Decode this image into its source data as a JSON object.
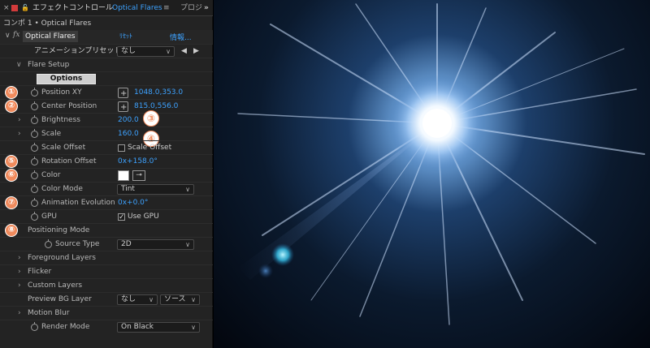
{
  "tabs": {
    "close_glyph": "×",
    "lock_glyph": "🔓",
    "effect_controls_label": "エフェクトコントロール",
    "effect_name": "Optical Flares",
    "menu_glyph": "≡",
    "project_tab": "プロジ",
    "overflow_glyph": "»"
  },
  "comp_path": "コンポ 1 • Optical Flares",
  "effect_header": {
    "fx_label": "fx",
    "name": "Optical Flares",
    "reset": "ﾘｾｯﾄ",
    "info": "情報..."
  },
  "preset": {
    "label": "アニメーションプリセット：",
    "value": "なし"
  },
  "flare_setup": {
    "label": "Flare Setup",
    "options_button": "Options"
  },
  "properties": {
    "position_xy": {
      "label": "Position XY",
      "value": "1048.0,353.0"
    },
    "center_position": {
      "label": "Center Position",
      "value": "815.0,556.0"
    },
    "brightness": {
      "label": "Brightness",
      "value": "200.0"
    },
    "scale": {
      "label": "Scale",
      "value": "160.0"
    },
    "scale_offset": {
      "label": "Scale Offset",
      "checkbox_label": "Scale Offset"
    },
    "rotation_offset": {
      "label": "Rotation Offset",
      "value": "0x+158.0°"
    },
    "color": {
      "label": "Color"
    },
    "color_mode": {
      "label": "Color Mode",
      "value": "Tint"
    },
    "animation_evolution": {
      "label": "Animation Evolution",
      "value": "0x+0.0°"
    },
    "gpu": {
      "label": "GPU",
      "checkbox_label": "Use GPU"
    }
  },
  "positioning_mode": {
    "label": "Positioning Mode",
    "source_type_label": "Source Type",
    "source_type_value": "2D"
  },
  "sections": {
    "foreground_layers": "Foreground Layers",
    "flicker": "Flicker",
    "custom_layers": "Custom Layers",
    "motion_blur": "Motion Blur"
  },
  "preview_bg": {
    "label": "Preview BG Layer",
    "value1": "なし",
    "value2": "ソース"
  },
  "render_mode": {
    "label": "Render Mode",
    "value": "On Black"
  },
  "badges": [
    "①",
    "②",
    "③",
    "④",
    "⑤",
    "⑥",
    "⑦",
    "⑧"
  ],
  "colors": {
    "accent_blue": "#3da2ff",
    "badge_orange": "#f08a5c",
    "panel_bg": "#232323"
  }
}
